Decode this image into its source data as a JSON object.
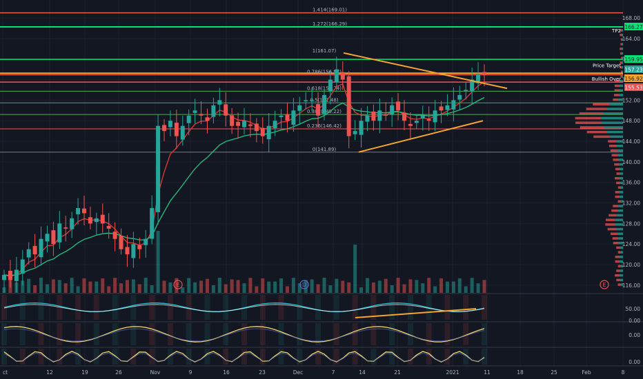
{
  "colors": {
    "background": "#131722",
    "grid": "#1e222d",
    "text": "#b2b5be",
    "up": "#26a69a",
    "down": "#ef5350",
    "fib_red": "#ff5252",
    "fib_green": "#4caf50",
    "bright_green": "#00e676",
    "orange": "#f7a531",
    "ema_fast": "#e53935",
    "ema_slow": "#26c281",
    "macd": "#f5d76e"
  },
  "price_axis": {
    "ticks": [
      "168.00",
      "164.00",
      "160.00",
      "156.00",
      "152.00",
      "148.00",
      "144.00",
      "140.00",
      "136.00",
      "132.00",
      "128.00",
      "124.00",
      "120.00",
      "116.00"
    ],
    "ylim": [
      114.5,
      171.5
    ]
  },
  "level_labels": [
    {
      "name": "tp2-label",
      "text": "TP2"
    },
    {
      "name": "price-target-label",
      "text": "Price Target"
    },
    {
      "name": "bullish-over-label",
      "text": "Bullish Over"
    }
  ],
  "price_badges": [
    {
      "name": "badge-166",
      "text": "166.27",
      "bg": "#00e676",
      "fg": "#131722",
      "price": 166.27
    },
    {
      "name": "badge-159",
      "text": "159.95",
      "bg": "#00e676",
      "fg": "#131722",
      "price": 159.95
    },
    {
      "name": "badge-157",
      "text": "157.23",
      "bg": "#26a69a",
      "fg": "#ffffff",
      "price": 157.23
    },
    {
      "name": "badge-156",
      "text": "156.92",
      "bg": "#f7a531",
      "fg": "#131722",
      "price": 156.92
    },
    {
      "name": "badge-155",
      "text": "155.53",
      "bg": "#ef5350",
      "fg": "#ffffff",
      "price": 155.53
    }
  ],
  "fib_labels": [
    {
      "name": "fib-1414",
      "text": "1.414(169.01)",
      "price": 169.01
    },
    {
      "name": "fib-1272",
      "text": "1.272(166.29)",
      "price": 166.29
    },
    {
      "name": "fib-1",
      "text": "1(161.07)",
      "price": 161.07
    },
    {
      "name": "fib-0786",
      "text": "0.786(156.97)",
      "price": 156.97
    },
    {
      "name": "fib-0618",
      "text": "0.618(153.74)",
      "price": 153.74
    },
    {
      "name": "fib-05",
      "text": "0.5(151.48)",
      "price": 151.48
    },
    {
      "name": "fib-0382",
      "text": "0.382(149.22)",
      "price": 149.22
    },
    {
      "name": "fib-0236",
      "text": "0.236(146.42)",
      "price": 146.42
    },
    {
      "name": "fib-0",
      "text": "0(141.89)",
      "price": 141.89
    }
  ],
  "event_markers": [
    "E",
    "D",
    "E"
  ],
  "x_axis": {
    "ticks": [
      "ct",
      "12",
      "19",
      "26",
      "Nov",
      "9",
      "16",
      "23",
      "Dec",
      "7",
      "14",
      "21",
      "2021",
      "11",
      "18",
      "25",
      "Feb",
      "8"
    ]
  },
  "indicator_axes": {
    "rsi": [
      "50.00",
      "0.00"
    ],
    "macd": [
      "0.00"
    ],
    "stoch": [
      "0.00"
    ]
  },
  "chart_data": [
    {
      "type": "candlestick",
      "description": "Daily price candles with EMA overlays, Fibonacci retracement levels, symmetrical triangle trendlines and volume profile",
      "closes": [
        118,
        117,
        119,
        121,
        123,
        122,
        125,
        126,
        124,
        128,
        127,
        129,
        131,
        130,
        128,
        129,
        128,
        127,
        125,
        123,
        122,
        124,
        123,
        125,
        131,
        147,
        146,
        148,
        145,
        147,
        149,
        150,
        149,
        148,
        151,
        152,
        149,
        147,
        147,
        148,
        147,
        146,
        145,
        147,
        148,
        149,
        148,
        150,
        151,
        152,
        152,
        149,
        153,
        156,
        158,
        156,
        145,
        146,
        148,
        149,
        148,
        150,
        149,
        151,
        150,
        148,
        147,
        148,
        149,
        148,
        150,
        150,
        151,
        152,
        153,
        154,
        156,
        157,
        157
      ],
      "fib_levels": [
        {
          "ratio": 1.414,
          "value": 169.01
        },
        {
          "ratio": 1.272,
          "value": 166.29
        },
        {
          "ratio": 1,
          "value": 161.07
        },
        {
          "ratio": 0.786,
          "value": 156.97
        },
        {
          "ratio": 0.618,
          "value": 153.74
        },
        {
          "ratio": 0.5,
          "value": 151.48
        },
        {
          "ratio": 0.382,
          "value": 149.22
        },
        {
          "ratio": 0.236,
          "value": 146.42
        },
        {
          "ratio": 0,
          "value": 141.89
        }
      ],
      "horizontal_levels": [
        169.01,
        166.27,
        159.95,
        157.23,
        156.92,
        155.53
      ],
      "ylim": [
        114.5,
        171.5
      ]
    },
    {
      "type": "bar",
      "description": "Volume"
    },
    {
      "type": "line",
      "description": "Oscillator with rising orange trendline",
      "ylim": [
        0,
        100
      ]
    },
    {
      "type": "line",
      "description": "MACD-style oscillator"
    },
    {
      "type": "line",
      "description": "Stochastic-style oscillator"
    }
  ]
}
